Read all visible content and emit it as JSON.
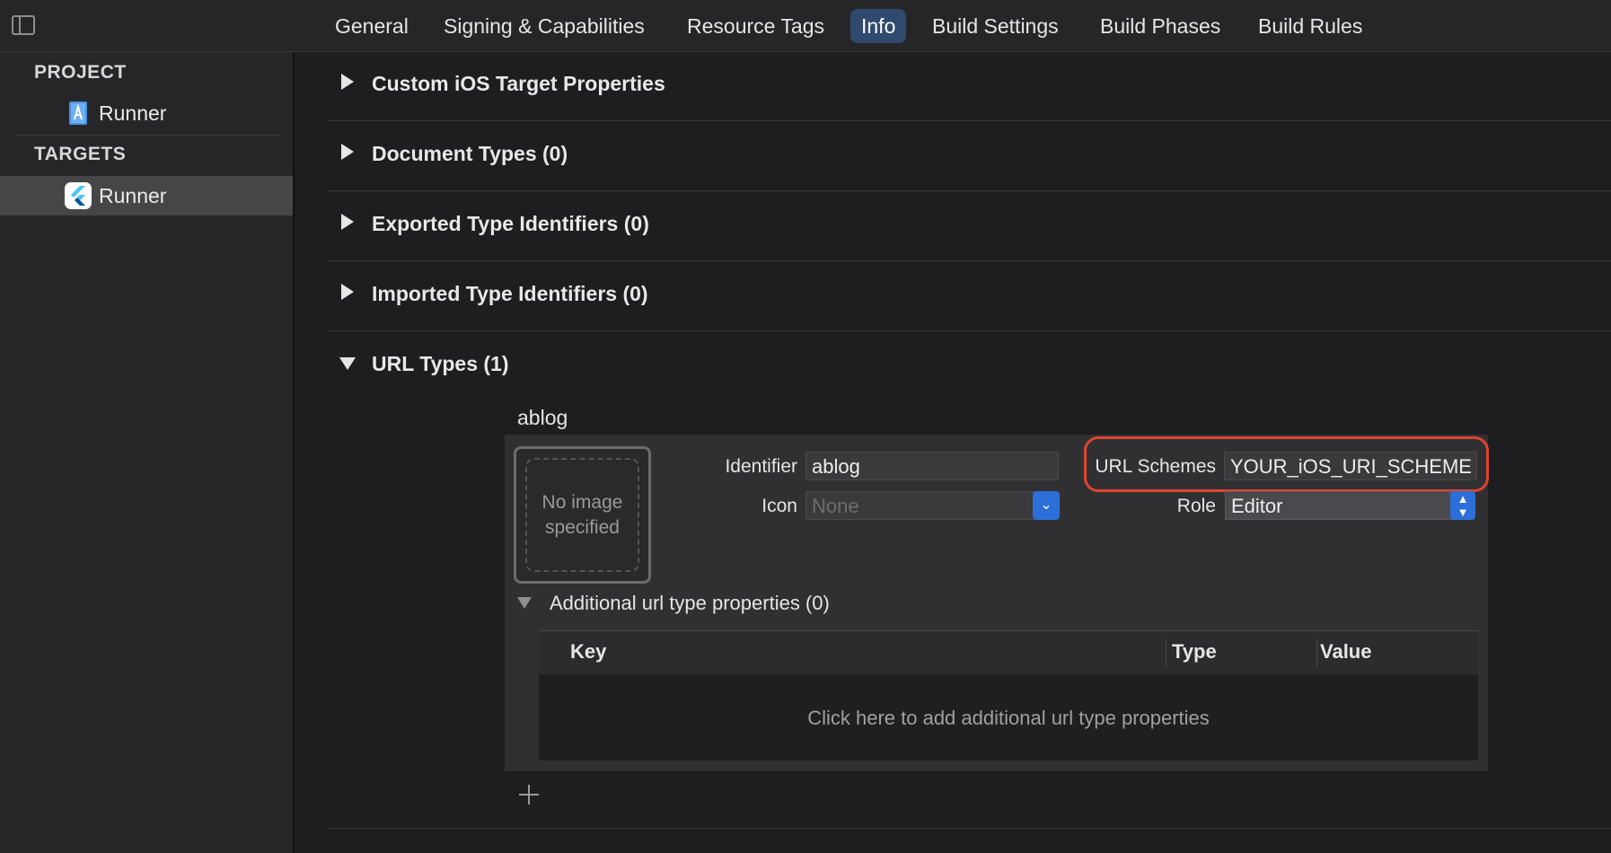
{
  "tabs": [
    {
      "label": "General",
      "active": false
    },
    {
      "label": "Signing & Capabilities",
      "active": false
    },
    {
      "label": "Resource Tags",
      "active": false
    },
    {
      "label": "Info",
      "active": true
    },
    {
      "label": "Build Settings",
      "active": false
    },
    {
      "label": "Build Phases",
      "active": false
    },
    {
      "label": "Build Rules",
      "active": false
    }
  ],
  "navigator": {
    "project_header": "PROJECT",
    "project_item": "Runner",
    "targets_header": "TARGETS",
    "target_item": "Runner"
  },
  "sections": [
    {
      "title": "Custom iOS Target Properties",
      "expanded": false
    },
    {
      "title": "Document Types (0)",
      "expanded": false
    },
    {
      "title": "Exported Type Identifiers (0)",
      "expanded": false
    },
    {
      "title": "Imported Type Identifiers (0)",
      "expanded": false
    },
    {
      "title": "URL Types (1)",
      "expanded": true
    }
  ],
  "url_type": {
    "name": "ablog",
    "image_placeholder": "No image specified",
    "identifier_label": "Identifier",
    "identifier_value": "ablog",
    "icon_label": "Icon",
    "icon_value": "None",
    "url_schemes_label": "URL Schemes",
    "url_schemes_value": "YOUR_iOS_URI_SCHEME",
    "role_label": "Role",
    "role_value": "Editor",
    "additional_title": "Additional url type properties (0)",
    "table_headers": {
      "key": "Key",
      "type": "Type",
      "value": "Value"
    },
    "table_empty": "Click here to add additional url type properties"
  },
  "colors": {
    "accent": "#2d6fd8",
    "highlight": "#e0432f",
    "selected_tab": "#2f4a6e"
  }
}
